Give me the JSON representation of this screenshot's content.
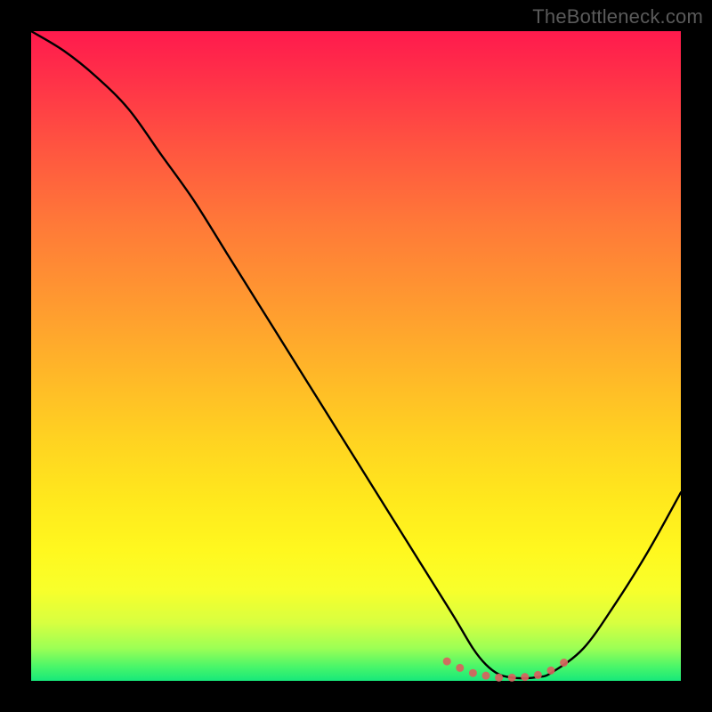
{
  "watermark": "TheBottleneck.com",
  "colors": {
    "background": "#000000",
    "curve": "#000000",
    "marker": "#d8625e",
    "gradient_top": "#ff1a4d",
    "gradient_bottom": "#17e87a"
  },
  "chart_data": {
    "type": "line",
    "title": "",
    "xlabel": "",
    "ylabel": "",
    "xlim": [
      0,
      100
    ],
    "ylim": [
      0,
      100
    ],
    "series": [
      {
        "name": "bottleneck-curve",
        "x": [
          0,
          5,
          10,
          15,
          20,
          25,
          30,
          35,
          40,
          45,
          50,
          55,
          60,
          65,
          68,
          70,
          72,
          74,
          76,
          78,
          80,
          85,
          90,
          95,
          100
        ],
        "y": [
          100,
          97,
          93,
          88,
          81,
          74,
          66,
          58,
          50,
          42,
          34,
          26,
          18,
          10,
          5,
          2.5,
          1,
          0.5,
          0.4,
          0.6,
          1.2,
          5,
          12,
          20,
          29
        ]
      }
    ],
    "markers": {
      "series": "bottleneck-curve",
      "indices_note": "cluster around the curve minimum",
      "x": [
        64,
        66,
        68,
        70,
        72,
        74,
        76,
        78,
        80,
        82
      ],
      "y": [
        3.0,
        2.0,
        1.2,
        0.8,
        0.5,
        0.5,
        0.6,
        0.9,
        1.6,
        2.8
      ]
    }
  }
}
